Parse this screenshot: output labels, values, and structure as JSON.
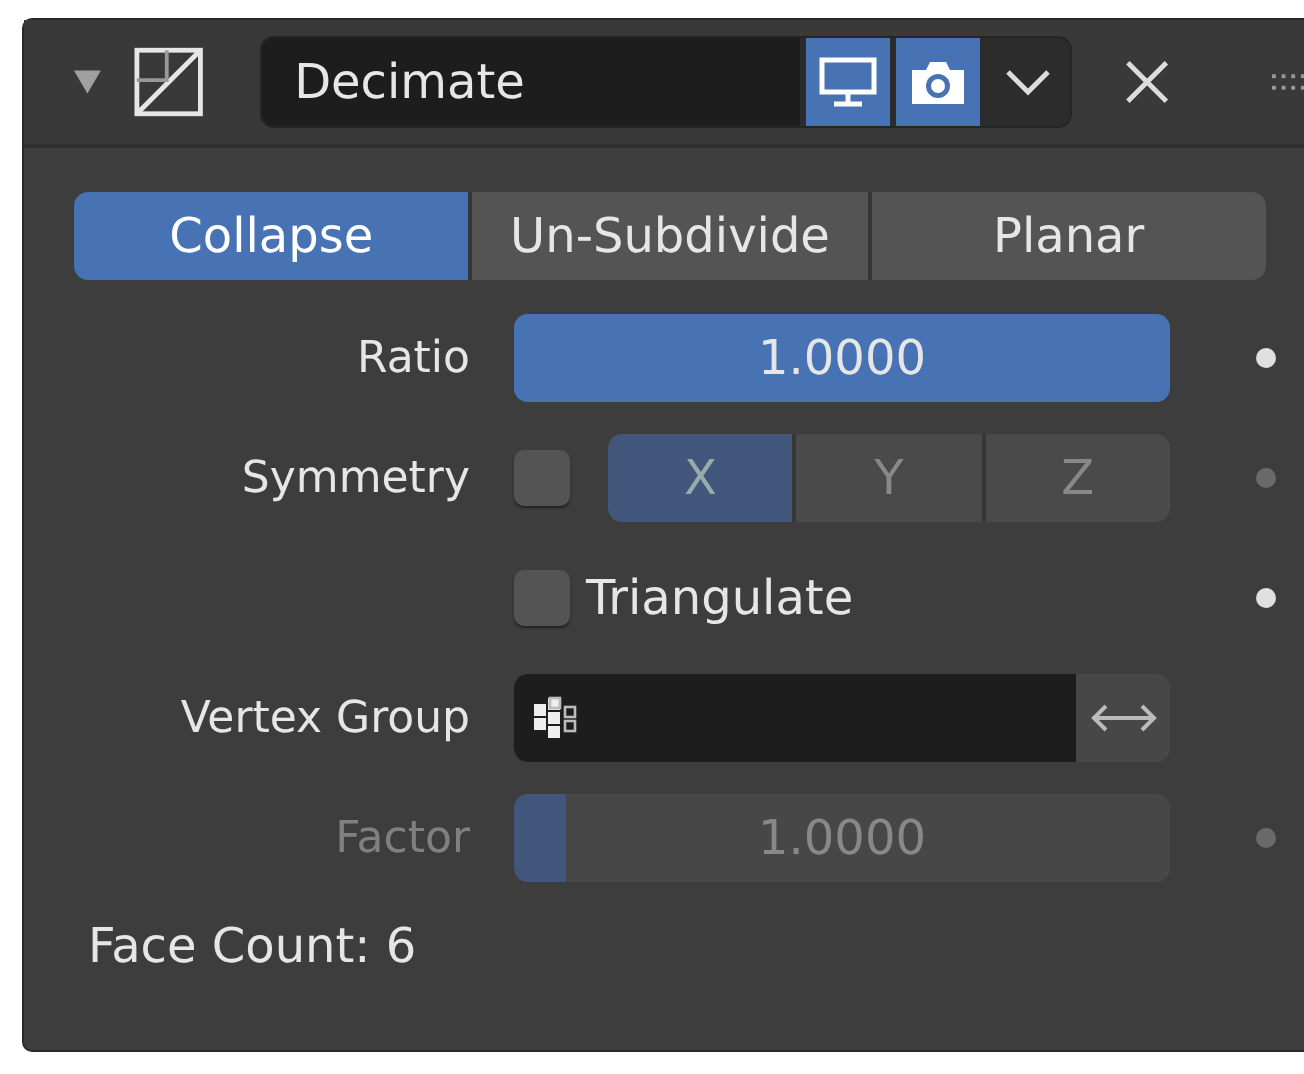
{
  "header": {
    "expanded": true,
    "name": "Decimate",
    "show_viewport": true,
    "show_render": true
  },
  "modes": [
    {
      "label": "Collapse",
      "selected": true
    },
    {
      "label": "Un-Subdivide",
      "selected": false
    },
    {
      "label": "Planar",
      "selected": false
    }
  ],
  "ratio": {
    "label": "Ratio",
    "value": "1.0000",
    "level": 1,
    "disabled": false
  },
  "symmetry": {
    "label": "Symmetry",
    "checked": false,
    "disabled": true,
    "axes": [
      {
        "label": "X",
        "selected": true
      },
      {
        "label": "Y",
        "selected": false
      },
      {
        "label": "Z",
        "selected": false
      }
    ]
  },
  "triangulate": {
    "label": "Triangulate",
    "checked": false
  },
  "vertex_group": {
    "label": "Vertex Group"
  },
  "factor": {
    "label": "Factor",
    "value": "1.0000",
    "level": 0.08,
    "disabled": true
  },
  "face_count": "Face Count: 6"
}
